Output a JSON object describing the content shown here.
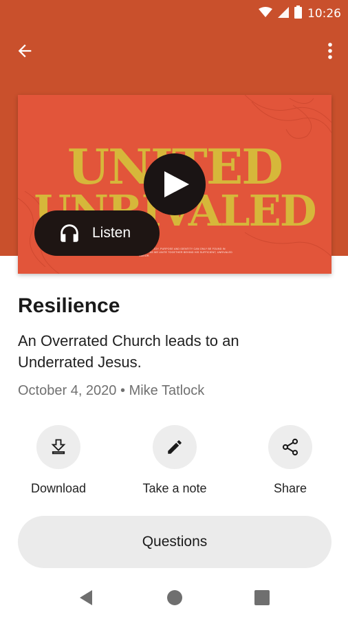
{
  "status_bar": {
    "time": "10:26",
    "icons": [
      "wifi-icon",
      "signal-icon",
      "battery-icon"
    ]
  },
  "app_bar": {
    "back_icon": "arrow-back-icon",
    "menu_icon": "more-vert-icon"
  },
  "artwork": {
    "title_line1": "UNITED",
    "title_line2": "UNRIVALED",
    "fine_print": "OUR TRUE JOY, PURPOSE AND IDENTITY CAN ONLY BE FOUND IN CHRIST AS WE UNITE TOGETHER BEHIND HIS SUFFICIENT, UNRIVALED SAVIOR.",
    "play_icon": "play-icon"
  },
  "listen": {
    "label": "Listen",
    "icon": "headphones-icon"
  },
  "sermon": {
    "title": "Resilience",
    "subtitle": "An Overrated Church leads to an Underrated Jesus.",
    "date": "October 4, 2020",
    "separator": "•",
    "speaker": "Mike Tatlock"
  },
  "actions": [
    {
      "label": "Download",
      "icon": "download-icon"
    },
    {
      "label": "Take a note",
      "icon": "pencil-icon"
    },
    {
      "label": "Share",
      "icon": "share-icon"
    }
  ],
  "questions_button": {
    "label": "Questions"
  },
  "colors": {
    "header": "#c9502c",
    "artwork_bg": "#e2553a",
    "artwork_text": "#d6b73a",
    "dark": "#1e1513",
    "chip": "#ebebeb"
  },
  "nav_bar": {
    "icons": [
      "nav-back-icon",
      "nav-home-icon",
      "nav-recents-icon"
    ]
  }
}
